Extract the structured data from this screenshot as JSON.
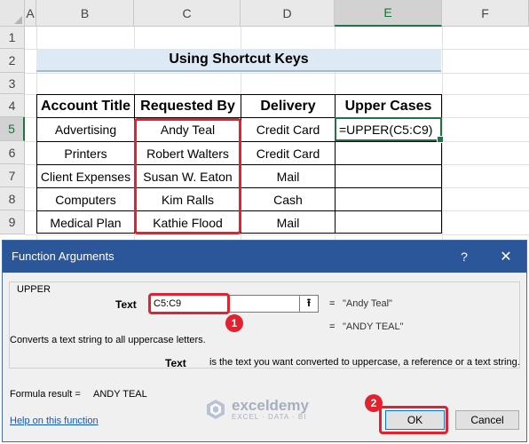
{
  "sheet": {
    "columns": [
      "A",
      "B",
      "C",
      "D",
      "E",
      "F"
    ],
    "rows": [
      "1",
      "2",
      "3",
      "4",
      "5",
      "6",
      "7",
      "8",
      "9"
    ],
    "title": "Using Shortcut Keys",
    "table": {
      "headers": [
        "Account Title",
        "Requested By",
        "Delivery",
        "Upper Cases"
      ],
      "rows": [
        [
          "Advertising",
          "Andy Teal",
          "Credit Card",
          "=UPPER(C5:C9)"
        ],
        [
          "Printers",
          "Robert Walters",
          "Credit Card",
          ""
        ],
        [
          "Client Expenses",
          "Susan W. Eaton",
          "Mail",
          ""
        ],
        [
          "Computers",
          "Kim Ralls",
          "Cash",
          ""
        ],
        [
          "Medical Plan",
          "Kathie Flood",
          "Mail",
          ""
        ]
      ]
    }
  },
  "dialog": {
    "title": "Function Arguments",
    "help_glyph": "?",
    "close_glyph": "✕",
    "function_name": "UPPER",
    "arg_label": "Text",
    "arg_value": "C5:C9",
    "collapse_glyph": "⭱",
    "equals": "=",
    "arg_result": "\"Andy Teal\"",
    "function_result": "\"ANDY TEAL\"",
    "description": "Converts a text string to all uppercase letters.",
    "arg_name": "Text",
    "arg_description": "is the text you want converted to uppercase, a reference or a text string.",
    "formula_result_label": "Formula result =",
    "formula_result_value": "ANDY TEAL",
    "help_link": "Help on this function",
    "ok_label": "OK",
    "cancel_label": "Cancel"
  },
  "annotations": {
    "step1": "1",
    "step2": "2"
  },
  "watermark": {
    "name": "exceldemy",
    "tagline": "EXCEL · DATA · BI"
  },
  "colors": {
    "excel_green": "#217346",
    "dialog_titlebar": "#2b579a",
    "highlight_red": "#e0232e",
    "title_fill": "#dde9f5"
  }
}
